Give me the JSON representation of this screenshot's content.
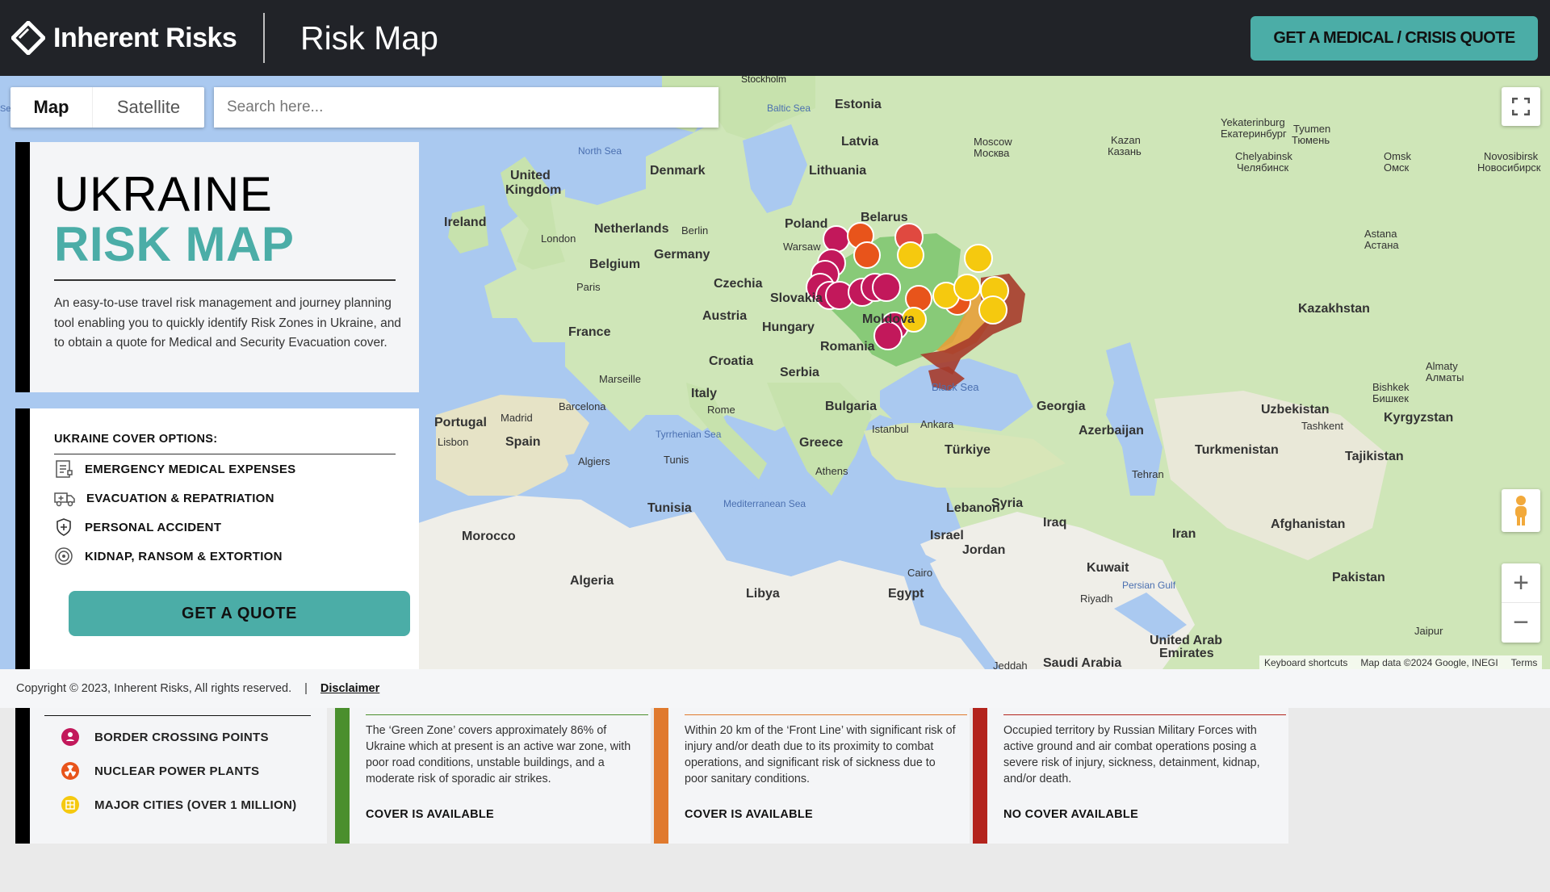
{
  "header": {
    "brand": "Inherent Risks",
    "page_title": "Risk Map",
    "quote_button": "GET A MEDICAL / CRISIS QUOTE"
  },
  "map": {
    "map_type_options": [
      "Map",
      "Satellite"
    ],
    "selected_map_type": "Map",
    "search_placeholder": "Search here...",
    "attribution": [
      "Keyboard shortcuts",
      "Map data ©2024 Google, INEGI",
      "Terms"
    ],
    "labels": {
      "seas": [
        "Sea",
        "Baltic Sea",
        "North Sea",
        "Black Sea",
        "Tyrrhenian Sea",
        "Mediterranean Sea",
        "Persian Gulf"
      ],
      "countries": [
        "Estonia",
        "Latvia",
        "Lithuania",
        "Belarus",
        "Poland",
        "Denmark",
        "United Kingdom",
        "Ireland",
        "Netherlands",
        "Germany",
        "Belgium",
        "Czechia",
        "France",
        "Austria",
        "Slovakia",
        "Hungary",
        "Moldova",
        "Romania",
        "Croatia",
        "Serbia",
        "Italy",
        "Bulgaria",
        "Greece",
        "Portugal",
        "Spain",
        "Tunisia",
        "Morocco",
        "Algeria",
        "Libya",
        "Egypt",
        "Türkiye",
        "Georgia",
        "Azerbaijan",
        "Syria",
        "Lebanon",
        "Israel",
        "Jordan",
        "Iraq",
        "Iran",
        "Kuwait",
        "Saudi Arabia",
        "United Arab Emirates",
        "Kazakhstan",
        "Uzbekistan",
        "Turkmenistan",
        "Tajikistan",
        "Kyrgyzstan",
        "Afghanistan",
        "Pakistan"
      ],
      "cities": [
        "Stockholm",
        "Berlin",
        "London",
        "Paris",
        "Warsaw",
        "Moscow\nМосква",
        "Kazan\nКазань",
        "Yekaterinburg\nЕкатеринбург",
        "Tyumen\nТюмень",
        "Chelyabinsk\nЧелябинск",
        "Omsk\nОмск",
        "Novosibirsk\nНовосибирск",
        "Astana\nАстана",
        "Almaty\nАлматы",
        "Bishkek\nБишкек",
        "Tashkent",
        "Tehran\nتهران",
        "Marseille",
        "Barcelona",
        "Rome",
        "Madrid",
        "Lisbon",
        "Algiers\nالجزائر مدينة",
        "Tunis\nتونس",
        "Athens\nΑθήνα",
        "Istanbul",
        "Ankara",
        "Cairo\nالقاهرة",
        "Riyadh\nالرياض",
        "Jaipur\nजयपुर",
        "Jeddah"
      ]
    }
  },
  "intro_card": {
    "title_line1": "UKRAINE",
    "title_line2": "RISK MAP",
    "description": "An easy-to-use travel risk management and journey planning tool enabling you to quickly identify Risk Zones in Ukraine, and to obtain a quote for Medical and Security Evacuation cover."
  },
  "cover_card": {
    "title": "UKRAINE COVER OPTIONS:",
    "options": [
      {
        "label": "EMERGENCY MEDICAL EXPENSES",
        "icon": "medical-expenses-icon"
      },
      {
        "label": "EVACUATION & REPATRIATION",
        "icon": "ambulance-icon"
      },
      {
        "label": "PERSONAL ACCIDENT",
        "icon": "shield-icon"
      },
      {
        "label": "KIDNAP, RANSOM & EXTORTION",
        "icon": "target-icon"
      }
    ],
    "button": "GET A QUOTE"
  },
  "footer": {
    "copyright": "Copyright © 2023, Inherent Risks, All rights reserved.",
    "separator": "|",
    "disclaimer": "Disclaimer"
  },
  "legend": {
    "markers": [
      {
        "label": "BORDER CROSSING POINTS",
        "color": "#c2185b"
      },
      {
        "label": "NUCLEAR POWER PLANTS",
        "color": "#e8541b"
      },
      {
        "label": "MAJOR CITIES (OVER 1 MILLION)",
        "color": "#f5c90f"
      }
    ],
    "zones": [
      {
        "color": "#4a8f2d",
        "text": "The ‘Green Zone’ covers approximately 86% of Ukraine which at present is an active war zone, with poor road conditions, unstable buildings, and a moderate risk of sporadic air strikes.",
        "cover": "COVER IS AVAILABLE"
      },
      {
        "color": "#e07a2e",
        "text": "Within 20 km of the ‘Front Line’ with significant risk of injury and/or death due to its proximity to combat operations, and significant risk of sickness due to poor sanitary conditions.",
        "cover": "COVER IS AVAILABLE"
      },
      {
        "color": "#b3241d",
        "text": "Occupied territory by Russian Military Forces with active ground and air combat operations posing a severe risk of injury, sickness, detainment, kidnap, and/or death.",
        "cover": "NO COVER AVAILABLE"
      }
    ]
  }
}
